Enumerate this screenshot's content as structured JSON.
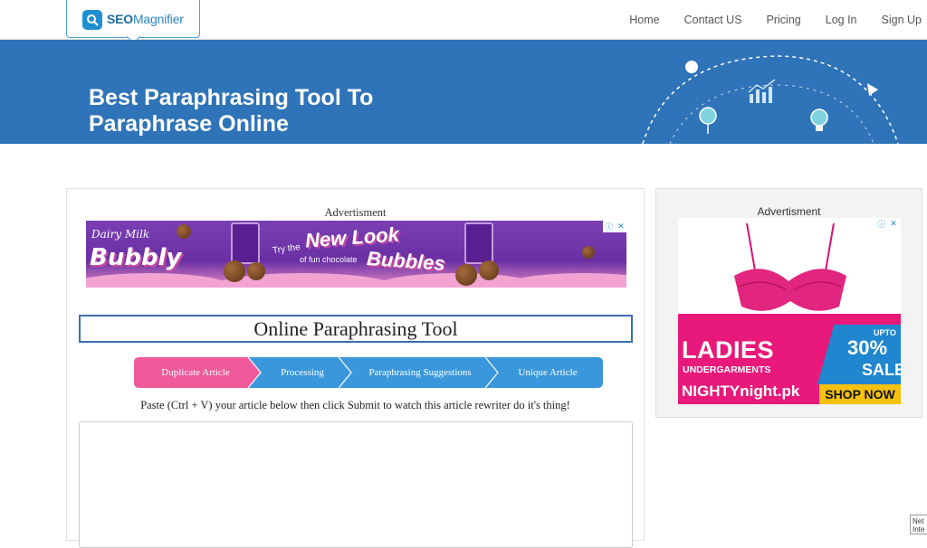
{
  "logo": {
    "brand_bold": "SEO",
    "brand_light": "Magnifier"
  },
  "nav": {
    "items": [
      "Home",
      "Contact US",
      "Pricing",
      "Log In",
      "Sign Up"
    ]
  },
  "hero": {
    "title_line1": "Best Paraphrasing Tool To",
    "title_line2": "Paraphrase Online"
  },
  "main": {
    "ad_label": "Advertisment",
    "banner": {
      "brand": "Dairy Milk",
      "bubbly": "Bubbly",
      "try": "Try the",
      "new_look": "New Look",
      "of_fun": "of fun chocolate",
      "bubbles": "Bubbles"
    },
    "tool_title": "Online Paraphrasing Tool",
    "steps": [
      "Duplicate Article",
      "Processing",
      "Paraphrasing Suggestions",
      "Unique Article"
    ],
    "instructions": "Paste (Ctrl + V) your article below then click Submit to watch this article rewriter do it's thing!",
    "input_value": ""
  },
  "sidebar": {
    "ad_label": "Advertisment",
    "ad": {
      "ladies": "LADIES",
      "undergarments": "UNDERGARMENTS",
      "upto": "UPTO",
      "percent": "30%",
      "sale": "SALE",
      "store": "NIGHTYnight.pk",
      "cta": "SHOP NOW"
    }
  },
  "corner_widget": "Net Inte",
  "colors": {
    "hero_blue": "#2f73b8",
    "step_active": "#ef5a9b",
    "step_blue": "#3a97db",
    "title_border": "#3b6fad"
  }
}
